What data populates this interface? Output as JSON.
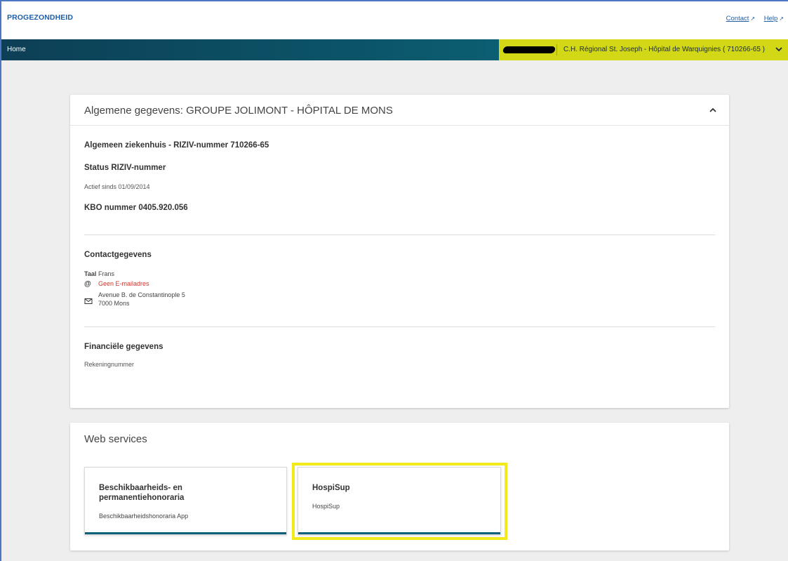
{
  "header": {
    "brand": "PROGEZONDHEID",
    "links": {
      "contact": "Contact",
      "help": "Help"
    }
  },
  "nav": {
    "home": "Home",
    "organization": "C.H. Régional St. Joseph - Hôpital de Warquignies ( 710266-65 )"
  },
  "general": {
    "title": "Algemene gegevens: GROUPE JOLIMONT - HÔPITAL DE MONS",
    "hospital_line": "Algemeen ziekenhuis - RIZIV-nummer  710266-65",
    "status_label": "Status RIZIV-nummer",
    "status_value": "Actief sinds 01/09/2014",
    "kbo_line": "KBO nummer  0405.920.056",
    "contact_title": "Contactgegevens",
    "lang_label": "Taal",
    "lang_value": "Frans",
    "email_value": "Geen E-mailadres",
    "address_line1": "Avenue B. de Constantinople 5",
    "address_line2": "7000 Mons",
    "financial_title": "Financiële gegevens",
    "account_label": "Rekeningnummer"
  },
  "webservices": {
    "title": "Web services",
    "tiles": [
      {
        "title": "Beschikbaarheids- en permanentiehonoraria",
        "subtitle": "Beschikbaarheidshonoraria App"
      },
      {
        "title": "HospiSup",
        "subtitle": "HospiSup"
      }
    ]
  },
  "colors": {
    "brand_blue": "#1f5fa8",
    "nav_teal": "#0b5468",
    "org_yellow": "#d2d816",
    "highlight_yellow": "#f2ea1a",
    "error_red": "#d0322a"
  }
}
